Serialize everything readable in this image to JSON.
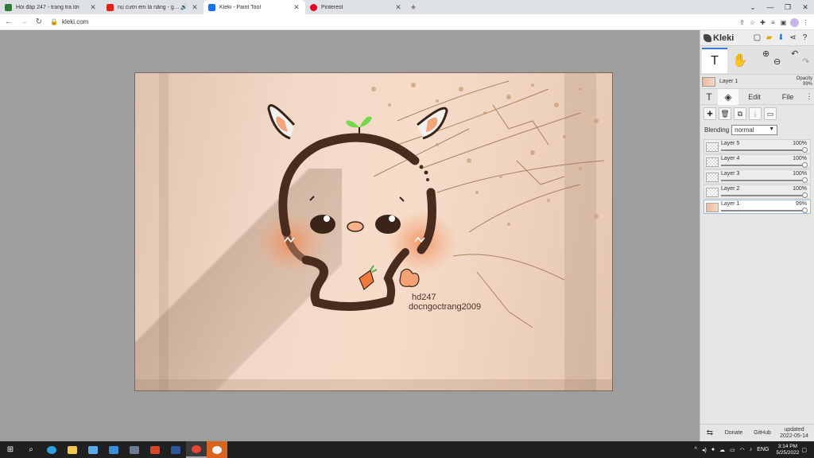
{
  "browser": {
    "tabs": [
      {
        "title": "Hỏi đáp 247 - trang tra lời",
        "favicon_color": "#2e7d32",
        "active": false,
        "audio": false
      },
      {
        "title": "nụ cười em là nắng - green ...",
        "favicon_color": "#e62117",
        "active": false,
        "audio": true
      },
      {
        "title": "Kleki - Paint Tool",
        "favicon_color": "#1a73e8",
        "active": true,
        "audio": false
      },
      {
        "title": "Pinterest",
        "favicon_color": "#e60023",
        "active": false,
        "audio": false
      }
    ],
    "new_tab_label": "+",
    "url": "kleki.com"
  },
  "canvas": {
    "signature_line1": "hd247",
    "signature_line2": "docngoctrang2009"
  },
  "panel": {
    "logo_text": "Kleki",
    "current_layer": {
      "name": "Layer 1",
      "opacity_label": "Opacity",
      "opacity_value": "99%"
    },
    "tabs": {
      "text_icon": "T",
      "edit": "Edit",
      "file": "File"
    },
    "blending_label": "Blending",
    "blending_value": "normal",
    "layers": [
      {
        "name": "Layer 5",
        "opacity": "100%",
        "level": 1.0,
        "selected": false
      },
      {
        "name": "Layer 4",
        "opacity": "100%",
        "level": 1.0,
        "selected": false
      },
      {
        "name": "Layer 3",
        "opacity": "100%",
        "level": 1.0,
        "selected": false
      },
      {
        "name": "Layer 2",
        "opacity": "100%",
        "level": 1.0,
        "selected": false
      },
      {
        "name": "Layer 1",
        "opacity": "99%",
        "level": 0.99,
        "selected": true
      }
    ],
    "footer": {
      "donate": "Donate",
      "github": "GitHub",
      "updated_label": "updated",
      "updated_date": "2022-05-14"
    }
  },
  "taskbar": {
    "language": "ENG",
    "time": "3:14 PM",
    "date": "5/25/2022"
  },
  "colors": {
    "accent": "#3c78d8",
    "taskbar_bg": "#202020",
    "workspace_bg": "#9e9e9e"
  }
}
